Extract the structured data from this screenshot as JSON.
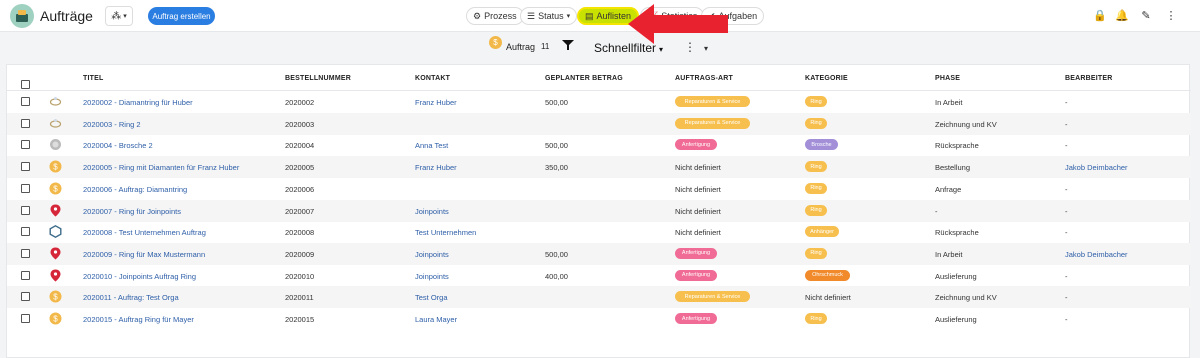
{
  "header": {
    "title": "Aufträge",
    "create_button": "Auftrag erstellen",
    "tabs": [
      {
        "label": "Prozess",
        "icon": "gear-icon"
      },
      {
        "label": "Status",
        "icon": "list-icon"
      },
      {
        "label": "Auflisten",
        "icon": "table-icon"
      },
      {
        "label": "Statistics",
        "icon": "chart-icon"
      },
      {
        "label": "Aufgaben",
        "icon": "check-circle-icon"
      }
    ],
    "right_icons": [
      "lock-icon",
      "bell-icon",
      "edit-icon",
      "more-vertical-icon"
    ]
  },
  "toolbar": {
    "count_label": "Auftrag",
    "count_value": "11",
    "quick_filter": "Schnellfilter"
  },
  "colors": {
    "accent_blue": "#2a7de1",
    "active_tab": "#c9e100",
    "arrow_red": "#e8232f",
    "badge_yellow": "#f7c04e",
    "badge_pink": "#f06b95",
    "badge_purple": "#a28fd8",
    "badge_orange": "#f08a2a"
  },
  "table": {
    "columns": [
      "TITEL",
      "BESTELLNUMMER",
      "KONTAKT",
      "GEPLANTER BETRAG",
      "AUFTRAGS-ART",
      "KATEGORIE",
      "PHASE",
      "BEARBEITER"
    ],
    "rows": [
      {
        "icon": "ring-icon",
        "titel": "2020002 - Diamantring für Huber",
        "nummer": "2020002",
        "kontakt": "Franz Huber",
        "betrag": "500,00",
        "art": "Reparaturen & Service",
        "art_type": "svc",
        "kategorie": "Ring",
        "kat_type": "ring",
        "phase": "In Arbeit",
        "bearbeiter": "-"
      },
      {
        "icon": "ring-icon",
        "titel": "2020003 - Ring 2",
        "nummer": "2020003",
        "kontakt": "",
        "betrag": "",
        "art": "Reparaturen & Service",
        "art_type": "svc",
        "kategorie": "Ring",
        "kat_type": "ring",
        "phase": "Zeichnung und KV",
        "bearbeiter": "-"
      },
      {
        "icon": "brooch-icon",
        "titel": "2020004 - Brosche 2",
        "nummer": "2020004",
        "kontakt": "Anna Test",
        "betrag": "500,00",
        "art": "Anfertigung",
        "art_type": "anf",
        "kategorie": "Brosche",
        "kat_type": "brosche",
        "phase": "Rücksprache",
        "bearbeiter": "-"
      },
      {
        "icon": "coin-icon",
        "titel": "2020005 - Ring mit Diamanten für Franz Huber",
        "nummer": "2020005",
        "kontakt": "Franz Huber",
        "betrag": "350,00",
        "art": "Nicht definiert",
        "art_type": "",
        "kategorie": "Ring",
        "kat_type": "ring",
        "phase": "Bestellung",
        "bearbeiter": "Jakob Deimbacher"
      },
      {
        "icon": "coin-icon",
        "titel": "2020006 - Auftrag: Diamantring",
        "nummer": "2020006",
        "kontakt": "",
        "betrag": "",
        "art": "Nicht definiert",
        "art_type": "",
        "kategorie": "Ring",
        "kat_type": "ring",
        "phase": "Anfrage",
        "bearbeiter": "-"
      },
      {
        "icon": "pin-icon",
        "titel": "2020007 - Ring für Joinpoints",
        "nummer": "2020007",
        "kontakt": "Joinpoints",
        "betrag": "",
        "art": "Nicht definiert",
        "art_type": "",
        "kategorie": "Ring",
        "kat_type": "ring",
        "phase": "-",
        "bearbeiter": "-"
      },
      {
        "icon": "hexagon-icon",
        "titel": "2020008 - Test Unternehmen Auftrag",
        "nummer": "2020008",
        "kontakt": "Test Unternehmen",
        "betrag": "",
        "art": "Nicht definiert",
        "art_type": "",
        "kategorie": "Anhänger",
        "kat_type": "anhaenger",
        "phase": "Rücksprache",
        "bearbeiter": "-"
      },
      {
        "icon": "pin-icon",
        "titel": "2020009 - Ring für Max Mustermann",
        "nummer": "2020009",
        "kontakt": "Joinpoints",
        "betrag": "500,00",
        "art": "Anfertigung",
        "art_type": "anf",
        "kategorie": "Ring",
        "kat_type": "ring",
        "phase": "In Arbeit",
        "bearbeiter": "Jakob Deimbacher"
      },
      {
        "icon": "pin-icon",
        "titel": "2020010 - Joinpoints Auftrag Ring",
        "nummer": "2020010",
        "kontakt": "Joinpoints",
        "betrag": "400,00",
        "art": "Anfertigung",
        "art_type": "anf",
        "kategorie": "Ohrschmuck",
        "kat_type": "ohr",
        "phase": "Auslieferung",
        "bearbeiter": "-"
      },
      {
        "icon": "coin-icon",
        "titel": "2020011 - Auftrag: Test Orga",
        "nummer": "2020011",
        "kontakt": "Test Orga",
        "betrag": "",
        "art": "Reparaturen & Service",
        "art_type": "svc",
        "kategorie": "Nicht definiert",
        "kat_type": "",
        "phase": "Zeichnung und KV",
        "bearbeiter": "-"
      },
      {
        "icon": "coin-icon",
        "titel": "2020015 - Auftrag Ring für Mayer",
        "nummer": "2020015",
        "kontakt": "Laura Mayer",
        "betrag": "",
        "art": "Anfertigung",
        "art_type": "anf",
        "kategorie": "Ring",
        "kat_type": "ring",
        "phase": "Auslieferung",
        "bearbeiter": "-"
      }
    ]
  }
}
